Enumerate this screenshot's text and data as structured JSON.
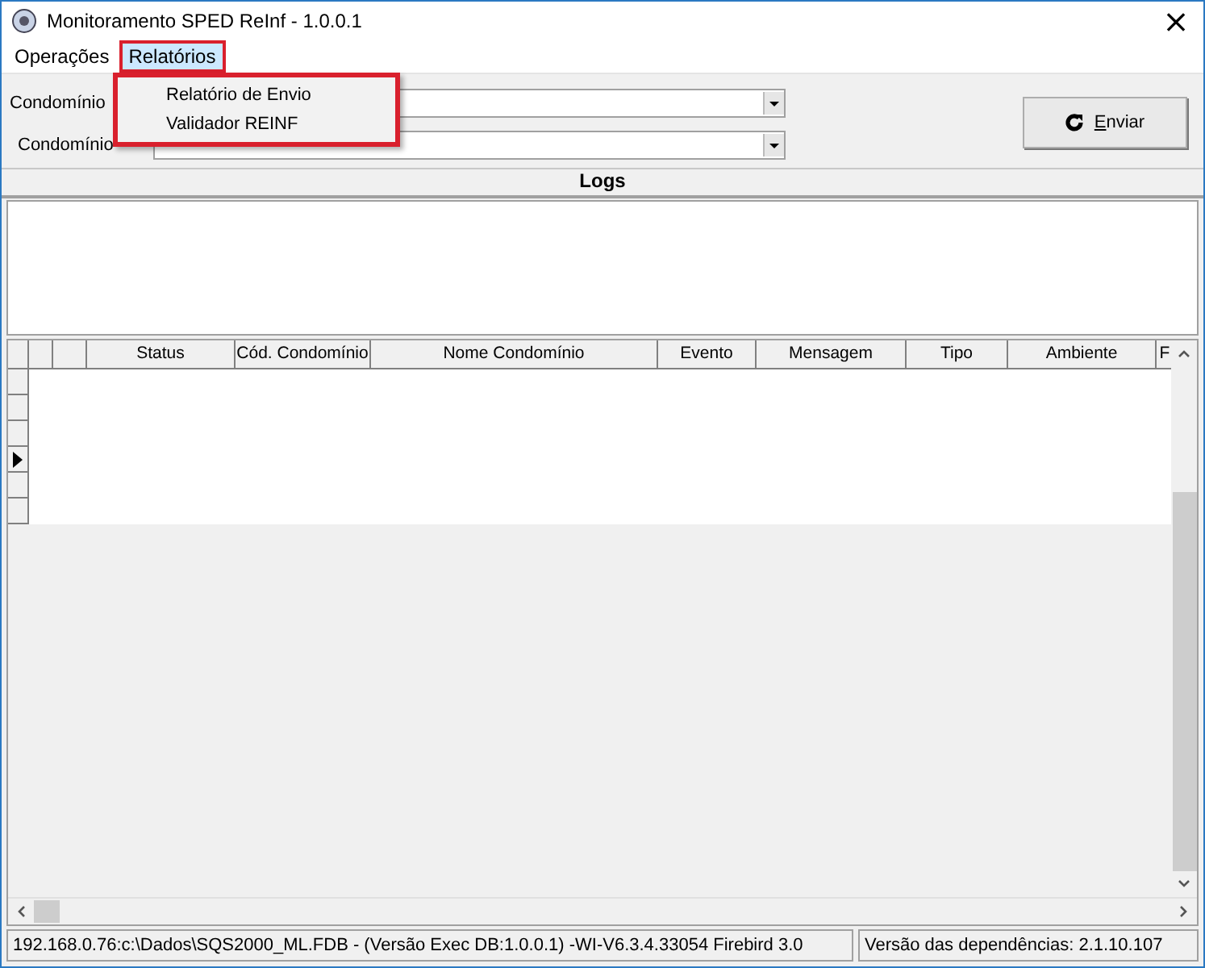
{
  "window": {
    "title": "Monitoramento SPED ReInf - 1.0.0.1",
    "close": "×"
  },
  "menu_bar": [
    {
      "label": "Operações",
      "selected": false
    },
    {
      "label": "Relatórios",
      "selected": true
    }
  ],
  "open_menu": {
    "items": [
      "Relatório de Envio",
      "Validador REINF"
    ]
  },
  "filters": [
    {
      "label": "Condomínio"
    },
    {
      "label": "Condomínio"
    }
  ],
  "send_button": {
    "label": "Enviar"
  },
  "logs": {
    "title": "Logs"
  },
  "table": {
    "columns": [
      "",
      "",
      "",
      "Status",
      "Cód. Condomínio",
      "Nome Condomínio",
      "Evento",
      "Mensagem",
      "Tipo",
      "Ambiente",
      "F"
    ],
    "rows": [
      {
        "selected": false
      },
      {
        "selected": false
      },
      {
        "selected": false
      },
      {
        "selected": true
      },
      {
        "selected": false
      },
      {
        "selected": false
      }
    ]
  },
  "status_bar": [
    "192.168.0.76:c:\\Dados\\SQS2000_ML.FDB - (Versão Exec DB:1.0.0.1) -WI-V6.3.4.33054 Firebird 3.0",
    "Versão das dependências: 2.1.10.107"
  ]
}
